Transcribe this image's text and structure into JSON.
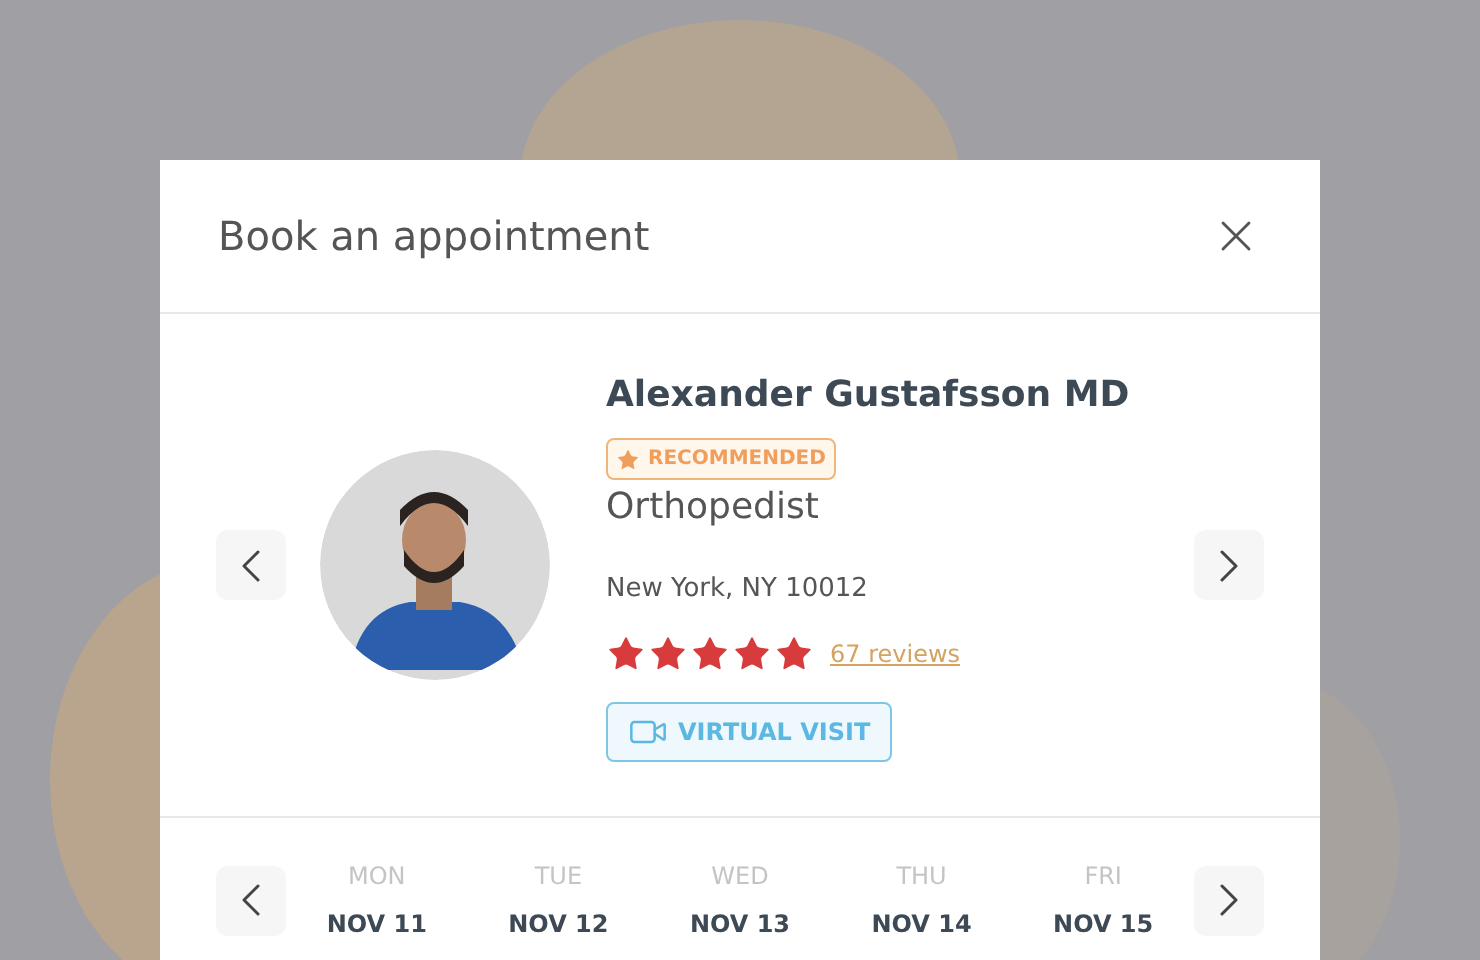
{
  "dialog": {
    "title": "Book an appointment"
  },
  "doctor": {
    "name": "Alexander Gustafsson MD",
    "badge": "RECOMMENDED",
    "specialty": "Orthopedist",
    "location": "New York, NY 10012",
    "stars": 5,
    "reviews": "67 reviews",
    "visit_button": "VIRTUAL VISIT"
  },
  "days": [
    {
      "weekday": "MON",
      "date": "NOV 11"
    },
    {
      "weekday": "TUE",
      "date": "NOV 12"
    },
    {
      "weekday": "WED",
      "date": "NOV 13"
    },
    {
      "weekday": "THU",
      "date": "NOV 14"
    },
    {
      "weekday": "FRI",
      "date": "NOV 15"
    }
  ]
}
